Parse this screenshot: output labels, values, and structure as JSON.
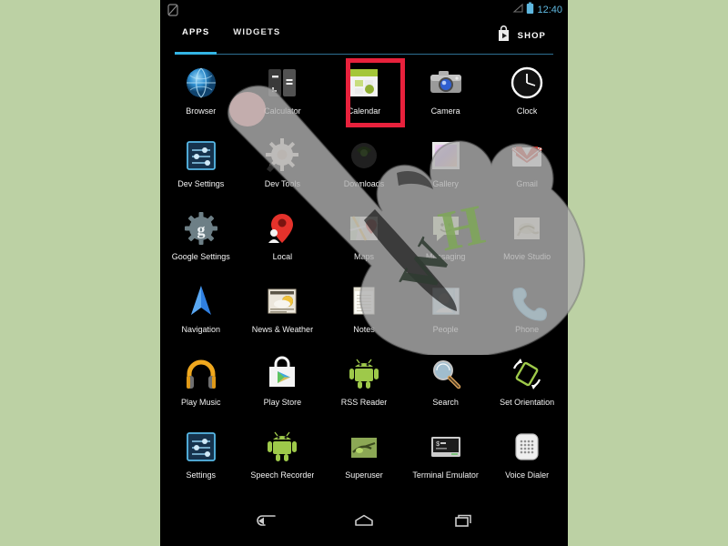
{
  "theme": {
    "page_background": "#bcd1a4",
    "screen_background": "#000000",
    "accent_blue": "#33b5e5",
    "highlight_red": "#e8213c",
    "caption_color": "#f2f2f2",
    "clock_color": "#5fb8e0"
  },
  "status_bar": {
    "rotation_icon": "screen-rotation-lock-icon",
    "signal_icon": "signal-triangle-icon",
    "battery_icon": "battery-icon",
    "time": "12:40"
  },
  "tab_bar": {
    "tabs": [
      {
        "label": "APPS",
        "active": true
      },
      {
        "label": "WIDGETS",
        "active": false
      }
    ],
    "shop": {
      "label": "SHOP",
      "icon": "play-store-bag-icon"
    }
  },
  "app_grid": {
    "columns": 5,
    "rows": [
      [
        {
          "label": "Browser",
          "icon": "browser-globe-icon",
          "selected": true
        },
        {
          "label": "Calculator",
          "icon": "calculator-icon",
          "selected": false
        },
        {
          "label": "Calendar",
          "icon": "calendar-icon",
          "selected": false
        },
        {
          "label": "Camera",
          "icon": "camera-icon",
          "selected": false
        },
        {
          "label": "Clock",
          "icon": "clock-icon",
          "selected": false
        }
      ],
      [
        {
          "label": "Dev Settings",
          "icon": "dev-settings-icon",
          "selected": false
        },
        {
          "label": "Dev Tools",
          "icon": "dev-tools-gear-icon",
          "selected": false
        },
        {
          "label": "Downloads",
          "icon": "downloads-icon",
          "selected": false
        },
        {
          "label": "Gallery",
          "icon": "gallery-icon",
          "selected": false
        },
        {
          "label": "Gmail",
          "icon": "gmail-envelope-icon",
          "selected": false
        }
      ],
      [
        {
          "label": "Google Settings",
          "icon": "google-settings-gear-icon",
          "selected": false
        },
        {
          "label": "Local",
          "icon": "local-map-pin-icon",
          "selected": false
        },
        {
          "label": "Maps",
          "icon": "maps-icon",
          "selected": false
        },
        {
          "label": "Messaging",
          "icon": "messaging-bubble-icon",
          "selected": false
        },
        {
          "label": "Movie Studio",
          "icon": "movie-studio-icon",
          "selected": false
        }
      ],
      [
        {
          "label": "Navigation",
          "icon": "navigation-arrow-icon",
          "selected": false
        },
        {
          "label": "News & Weather",
          "icon": "news-weather-icon",
          "selected": false
        },
        {
          "label": "Notes",
          "icon": "notes-icon",
          "selected": false
        },
        {
          "label": "People",
          "icon": "people-contact-icon",
          "selected": false
        },
        {
          "label": "Phone",
          "icon": "phone-handset-icon",
          "selected": false
        }
      ],
      [
        {
          "label": "Play Music",
          "icon": "play-music-headphones-icon",
          "selected": false
        },
        {
          "label": "Play Store",
          "icon": "play-store-bag-icon",
          "selected": false
        },
        {
          "label": "RSS Reader",
          "icon": "android-robot-icon",
          "selected": false
        },
        {
          "label": "Search",
          "icon": "search-magnifier-icon",
          "selected": false
        },
        {
          "label": "Set Orientation",
          "icon": "set-orientation-icon",
          "selected": false
        }
      ],
      [
        {
          "label": "Settings",
          "icon": "settings-sliders-icon",
          "selected": false
        },
        {
          "label": "Speech Recorder",
          "icon": "android-robot-icon",
          "selected": false
        },
        {
          "label": "Superuser",
          "icon": "superuser-icon",
          "selected": false
        },
        {
          "label": "Terminal Emulator",
          "icon": "terminal-icon",
          "selected": false
        },
        {
          "label": "Voice Dialer",
          "icon": "voice-dialer-icon",
          "selected": false
        }
      ]
    ]
  },
  "nav_bar": {
    "buttons": [
      {
        "label": "Back",
        "icon": "back-arrow-icon"
      },
      {
        "label": "Home",
        "icon": "home-icon"
      },
      {
        "label": "Recents",
        "icon": "recents-icon"
      }
    ]
  },
  "overlays": {
    "hand_cursor": "pointing-hand-cursor",
    "watermark": "wikihow-wh-watermark"
  }
}
